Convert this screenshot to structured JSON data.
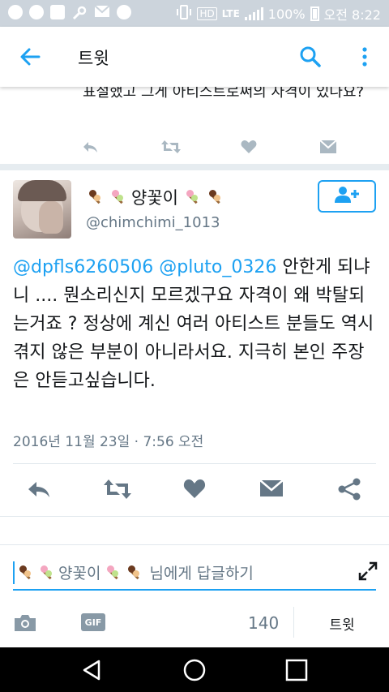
{
  "status_bar": {
    "battery": "100%",
    "time": "오전 8:22",
    "network": "LTE",
    "hd": "HD",
    "icons": [
      "ok-cashbag-icon",
      "g-app-icon",
      "photo-icon",
      "wrench-icon",
      "mail-icon",
      "sync-icon",
      "vibrate-icon",
      "hd-icon",
      "lte-icon",
      "signal-icon",
      "battery-icon"
    ]
  },
  "app_bar": {
    "title": "트윗",
    "accent_color": "#1da1f2"
  },
  "previous_tweet": {
    "text": "표절했고 그게 아티스트로써의 자격이 있나요?"
  },
  "tweet": {
    "display_name": "양꽃이",
    "handle": "@chimchimi_1013",
    "mention_1": "@dpfls6260506",
    "mention_2": "@pluto_0326",
    "body": " 안한게 되냐니 .... 뭔소리신지 모르겠구요 자격이 왜 박탈되는거죠 ? 정상에 계신 여러 아티스트 분들도 역시 겪지 않은 부분이 아니라서요. 지극히 본인 주장은 안듣고싶습니다.",
    "timestamp": "2016년 11월 23일 · 7:56 오전"
  },
  "reply": {
    "target_name": "양꽃이",
    "placeholder_suffix": "님에게 답글하기",
    "char_count": "140",
    "tweet_button": "트윗"
  }
}
